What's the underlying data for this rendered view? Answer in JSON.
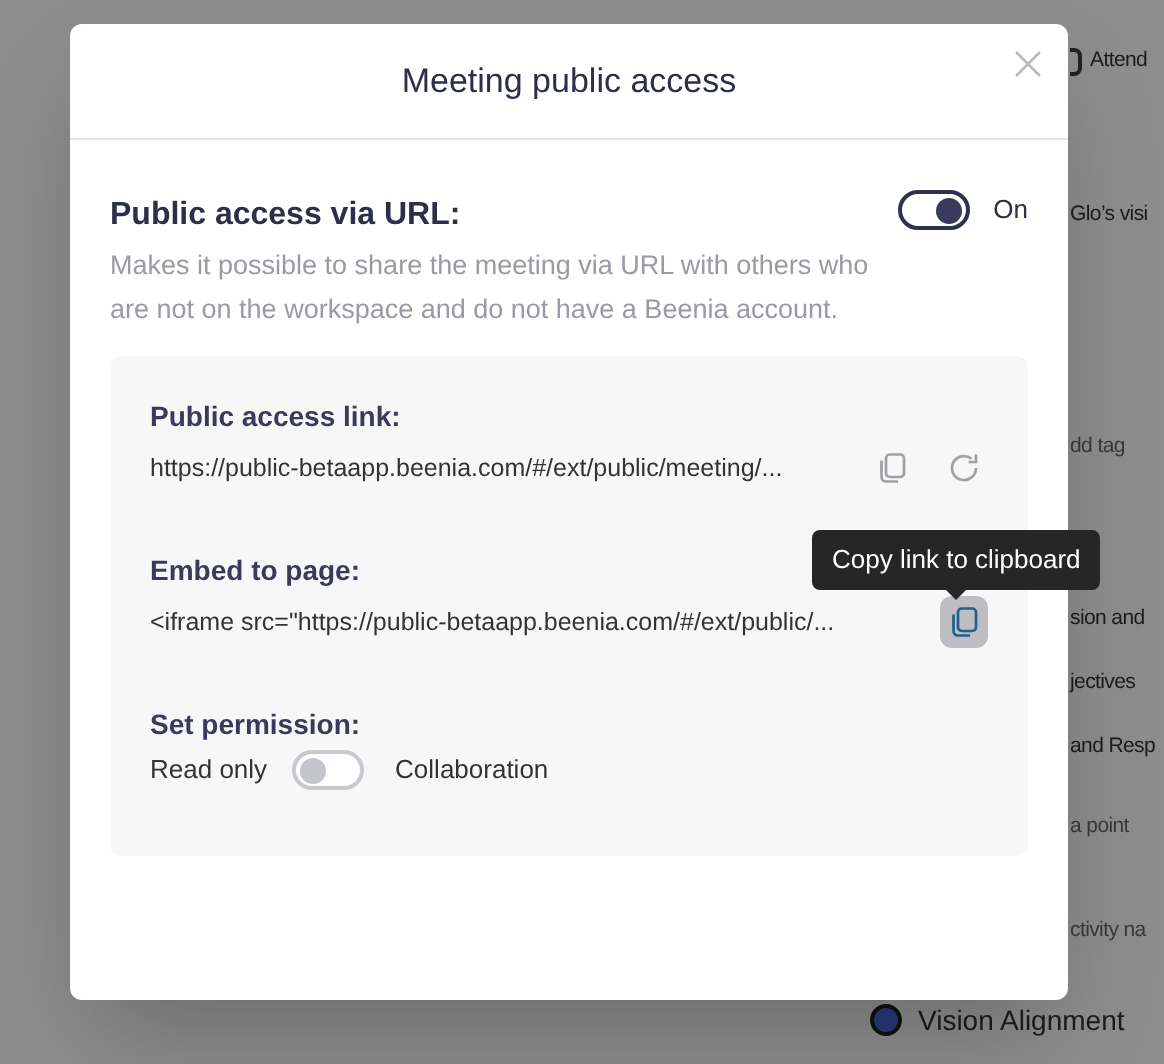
{
  "background": {
    "items": [
      {
        "text": "Attend",
        "kind": "icon-label"
      },
      {
        "text": "Glo’s visi",
        "kind": "text"
      },
      {
        "text": "dd tag",
        "kind": "muted"
      },
      {
        "text": "sion and",
        "kind": "text"
      },
      {
        "text": "jectives",
        "kind": "text"
      },
      {
        "text": "and Resp",
        "kind": "text"
      },
      {
        "text": "a point",
        "kind": "muted"
      },
      {
        "text": "ctivity na",
        "kind": "muted"
      },
      {
        "text": "Vision Alignment",
        "kind": "dot-label"
      }
    ]
  },
  "modal": {
    "title": "Meeting public access",
    "public_access": {
      "label": "Public access via URL:",
      "on": true,
      "state_label": "On",
      "description": "Makes it possible to share the meeting via URL with others who are not on the workspace and do not have a Beenia account."
    },
    "links": [
      {
        "label": "Public access link:",
        "value": "https://public-betaapp.beenia.com/#/ext/public/meeting/...",
        "actions": [
          {
            "kind": "copy",
            "hovered": false
          },
          {
            "kind": "refresh",
            "hovered": false
          }
        ]
      },
      {
        "label": "Embed to page:",
        "value": "<iframe src=\"https://public-betaapp.beenia.com/#/ext/public/...",
        "actions": [
          {
            "kind": "copy",
            "hovered": true,
            "tooltip": "Copy link to clipboard"
          }
        ]
      }
    ],
    "permission": {
      "label": "Set permission:",
      "left_label": "Read only",
      "right_label": "Collaboration",
      "on": false
    }
  }
}
